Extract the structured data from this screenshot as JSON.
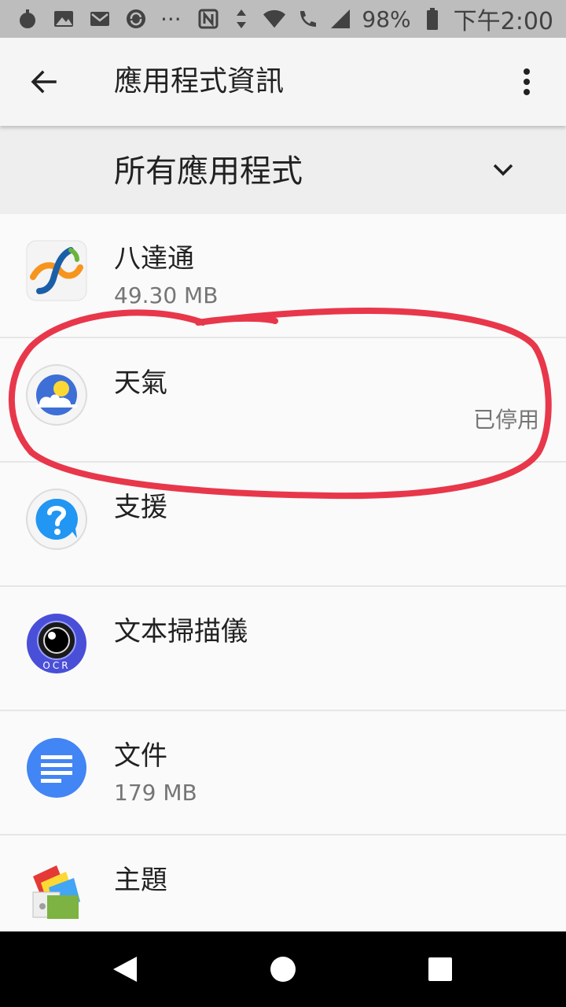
{
  "status_bar": {
    "battery": "98%",
    "time": "下午2:00",
    "icons_left": [
      "app-notification-icon",
      "image-notification-icon",
      "mail-icon",
      "sync-notification-icon",
      "more-notifications-icon"
    ],
    "icons_right": [
      "nfc-icon",
      "data-transfer-icon",
      "wifi-icon",
      "wifi-calling-icon",
      "signal-icon",
      "battery-icon"
    ],
    "more_glyph": "···"
  },
  "app_bar": {
    "title": "應用程式資訊",
    "back_icon": "back-arrow-icon",
    "more_icon": "more-vert-icon"
  },
  "filter": {
    "label": "所有應用程式",
    "icon": "chevron-down-icon"
  },
  "apps": [
    {
      "name": "八達通",
      "size": "49.30 MB",
      "status": "",
      "icon": "octopus-app-icon"
    },
    {
      "name": "天氣",
      "size": "",
      "status": "已停用",
      "icon": "weather-app-icon"
    },
    {
      "name": "支援",
      "size": "",
      "status": "",
      "icon": "support-app-icon"
    },
    {
      "name": "文本掃描儀",
      "size": "",
      "status": "",
      "icon": "ocr-scanner-app-icon",
      "icon_text": "OCR"
    },
    {
      "name": "文件",
      "size": "179 MB",
      "status": "",
      "icon": "docs-app-icon"
    },
    {
      "name": "主題",
      "size": "",
      "status": "",
      "icon": "themes-app-icon"
    }
  ],
  "nav_bar": {
    "back_icon": "nav-back-icon",
    "home_icon": "nav-home-icon",
    "recents_icon": "nav-recents-icon"
  },
  "colors": {
    "annotation": "#e8374a",
    "status_bar_bg": "#bdbdbd",
    "app_bar_bg": "#f5f5f5",
    "filter_bg": "#eeeeee",
    "list_bg": "#fafafa"
  }
}
